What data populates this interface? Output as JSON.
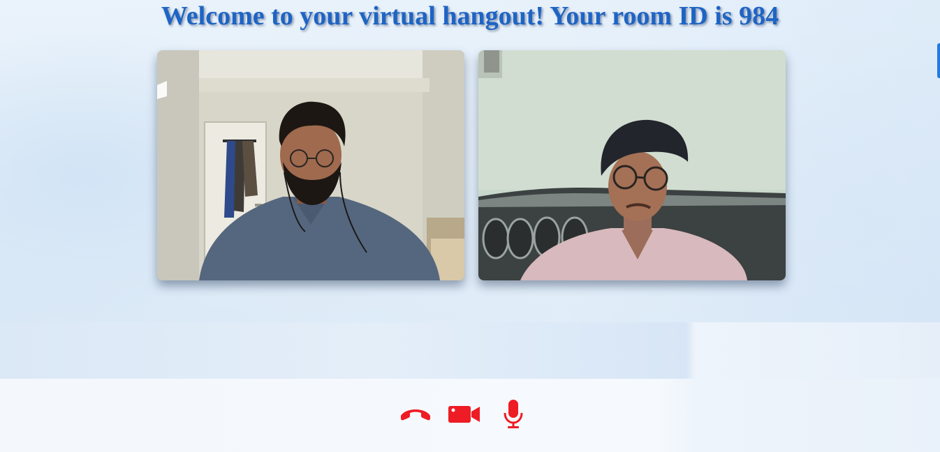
{
  "page": {
    "title": "Welcome to your virtual hangout! Your room ID is 984"
  },
  "videos": [
    {
      "participant": "local"
    },
    {
      "participant": "remote"
    }
  ],
  "controls": {
    "hangup_icon": "phone-hangup-icon",
    "camera_icon": "video-camera-icon",
    "mic_icon": "microphone-icon",
    "icon_color": "#ee1c24"
  },
  "colors": {
    "title": "#1e64c4",
    "accent": "#1f7be0"
  }
}
